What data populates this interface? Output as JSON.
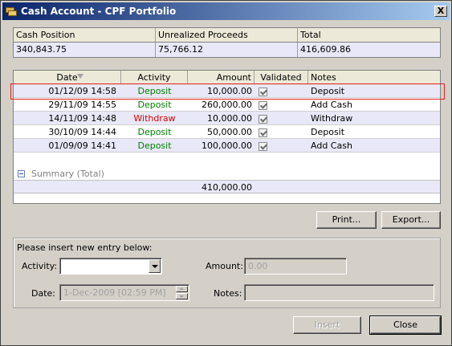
{
  "window": {
    "title": "Cash Account - CPF Portfolio",
    "close_label": "X"
  },
  "cash": {
    "headers": [
      "Cash Position",
      "Unrealized Proceeds",
      "Total"
    ],
    "values": [
      "340,843.75",
      "75,766.12",
      "416,609.86"
    ]
  },
  "transactions": {
    "headers": [
      "Date",
      "Activity",
      "Amount",
      "Validated",
      "Notes"
    ],
    "rows": [
      {
        "date": "01/12/09 14:58",
        "activity": "Deposit",
        "amount": "10,000.00",
        "notes": "Deposit"
      },
      {
        "date": "29/11/09 14:55",
        "activity": "Deposit",
        "amount": "260,000.00",
        "notes": "Add Cash"
      },
      {
        "date": "14/11/09 14:48",
        "activity": "Withdraw",
        "amount": "10,000.00",
        "notes": "Withdraw"
      },
      {
        "date": "30/10/09 14:44",
        "activity": "Deposit",
        "amount": "50,000.00",
        "notes": "Deposit"
      },
      {
        "date": "01/09/09 14:41",
        "activity": "Deposit",
        "amount": "100,000.00",
        "notes": "Add Cash"
      }
    ],
    "summary_label": "Summary (Total)",
    "total_amount": "410,000.00",
    "activity_colors": {
      "Deposit": "#008000",
      "Withdraw": "#e00000"
    }
  },
  "toolbar": {
    "print_label": "Print...",
    "export_label": "Export..."
  },
  "entry": {
    "prompt": "Please insert new entry below:",
    "activity_label": "Activity:",
    "activity_value": "",
    "amount_label": "Amount:",
    "amount_value": "0.00",
    "date_label": "Date:",
    "date_value": "1-Dec-2009 [02:59 PM]",
    "notes_label": "Notes:",
    "notes_value": ""
  },
  "footer": {
    "insert_label": "Insert",
    "close_label": "Close"
  }
}
